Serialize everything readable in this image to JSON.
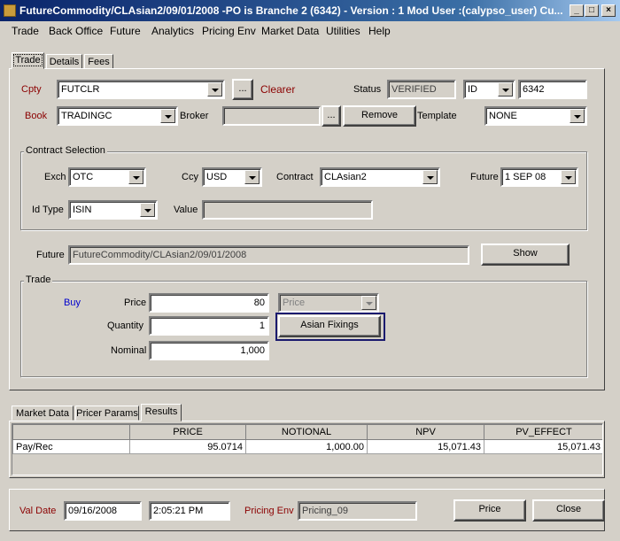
{
  "window": {
    "title": "FutureCommodity/CLAsian2/09/01/2008  -PO is Branche 2  (6342) - Version : 1 Mod User :(calypso_user) Cu...",
    "controls": {
      "minimize": "_",
      "maximize": "□",
      "close": "×"
    }
  },
  "menu": [
    "Trade",
    "Back Office",
    "Future",
    "Analytics",
    "Pricing Env",
    "Market Data",
    "Utilities",
    "Help"
  ],
  "top_tabs": [
    "Trade",
    "Details",
    "Fees"
  ],
  "trade_header": {
    "cpty_label": "Cpty",
    "cpty_value": "FUTCLR",
    "ellipsis": "...",
    "clearer_label": "Clearer",
    "status_label": "Status",
    "status_value": "VERIFIED",
    "id_type_value": "ID",
    "id_value": "6342",
    "book_label": "Book",
    "book_value": "TRADINGC",
    "broker_label": "Broker",
    "broker_value": "",
    "remove_label": "Remove",
    "template_label": "Template",
    "template_value": "NONE"
  },
  "contract_selection": {
    "title": "Contract Selection",
    "exch_label": "Exch",
    "exch_value": "OTC",
    "ccy_label": "Ccy",
    "ccy_value": "USD",
    "contract_label": "Contract",
    "contract_value": "CLAsian2",
    "future_label": "Future",
    "future_value": "1 SEP 08",
    "idtype_label": "Id Type",
    "idtype_value": "ISIN",
    "value_label": "Value",
    "value_value": ""
  },
  "future_row": {
    "label": "Future",
    "value": "FutureCommodity/CLAsian2/09/01/2008",
    "show_label": "Show"
  },
  "trade_group": {
    "title": "Trade",
    "direction": "Buy",
    "price_label": "Price",
    "price_value": "80",
    "price_type_value": "Price",
    "quantity_label": "Quantity",
    "quantity_value": "1",
    "asian_fixings_label": "Asian Fixings",
    "nominal_label": "Nominal",
    "nominal_value": "1,000"
  },
  "bottom_tabs": [
    "Market Data",
    "Pricer Params",
    "Results"
  ],
  "results": {
    "columns": [
      "",
      "PRICE",
      "NOTIONAL",
      "NPV",
      "PV_EFFECT"
    ],
    "rows": [
      [
        "Pay/Rec",
        "95.0714",
        "1,000.00",
        "15,071.43",
        "15,071.43"
      ]
    ]
  },
  "footer": {
    "val_date_label": "Val Date",
    "val_date": "09/16/2008",
    "val_time": "2:05:21 PM",
    "pricing_env_label": "Pricing Env",
    "pricing_env_value": "Pricing_09",
    "price_button": "Price",
    "close_button": "Close"
  },
  "colors": {
    "label_red": "#8b0000",
    "buy_blue": "#0000cd",
    "focus_border": "#1a1a6e",
    "titlebar": "#0a246a"
  }
}
